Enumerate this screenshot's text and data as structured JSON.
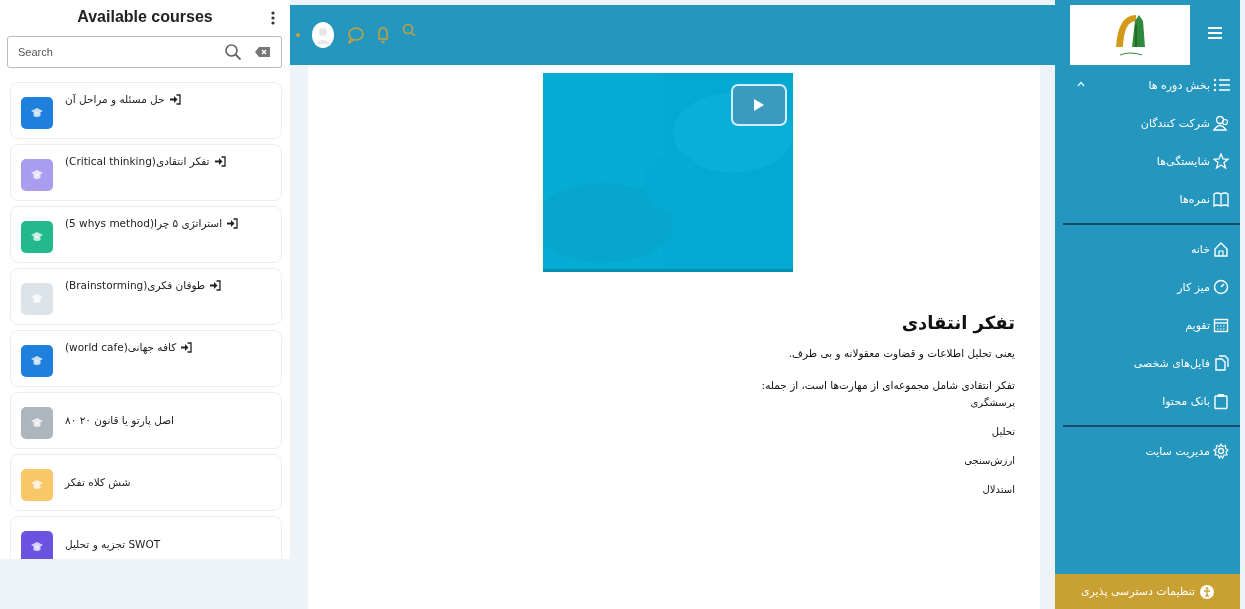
{
  "courses_panel": {
    "title": "Available courses",
    "search": {
      "placeholder": "Search"
    },
    "courses": [
      {
        "title": "حل مسئله و مراحل آن",
        "color": "#1f7fdc",
        "enrol_link": true
      },
      {
        "title": "(Critical thinking)تفکر انتقادی",
        "color": "#a99df0",
        "enrol_link": true
      },
      {
        "title": "(5 whys method)استراتژی ۵ چرا",
        "color": "#22b98c",
        "enrol_link": true
      },
      {
        "title": "(Brainstorming)طوفان فکری",
        "color": "#dde3e8",
        "enrol_link": true
      },
      {
        "title": "(world cafe)کافه جهانی",
        "color": "#1f7fdc",
        "enrol_link": true
      },
      {
        "title": "اصل پارتو یا قانون ۲۰ ۸۰",
        "color": "#adb5bd",
        "enrol_link": false
      },
      {
        "title": "شش کلاه تفکر",
        "color": "#f7c768",
        "enrol_link": false
      },
      {
        "title": "تجزیه و تحلیل SWOT",
        "color": "#6b52e0",
        "enrol_link": false
      }
    ]
  },
  "content": {
    "video": {
      "kind": "picture"
    },
    "heading": "تفکر انتقادی",
    "paragraphs": [
      "یعنی تحلیل اطلاعات و قضاوت معقولانه و بی طرف.",
      "تفکر انتقادی شامل مجموعه‌ای از مهارت‌ها است، از جمله:"
    ],
    "skills": [
      "پرسشگری",
      "تحلیل",
      "ارزش‌سنجی",
      "استدلال"
    ]
  },
  "sidebar": {
    "groups": [
      [
        {
          "label": "بخش دوره ها",
          "expanded": true
        },
        {
          "label": "شرکت کنندگان",
          "expanded": false
        },
        {
          "label": "شایستگی‌ها",
          "expanded": false
        },
        {
          "label": "نمره‌ها",
          "expanded": false
        }
      ],
      [
        {
          "label": "خانه",
          "expanded": false
        },
        {
          "label": "میز کار",
          "expanded": false
        },
        {
          "label": "تقویم",
          "expanded": false
        },
        {
          "label": "فایل‌های شخصی",
          "expanded": false
        },
        {
          "label": "بانک محتوا",
          "expanded": false
        }
      ],
      [
        {
          "label": "مدیریت سایت",
          "expanded": false
        }
      ]
    ],
    "accessibility_button": "تنظیمات دسترسی پذیری"
  }
}
